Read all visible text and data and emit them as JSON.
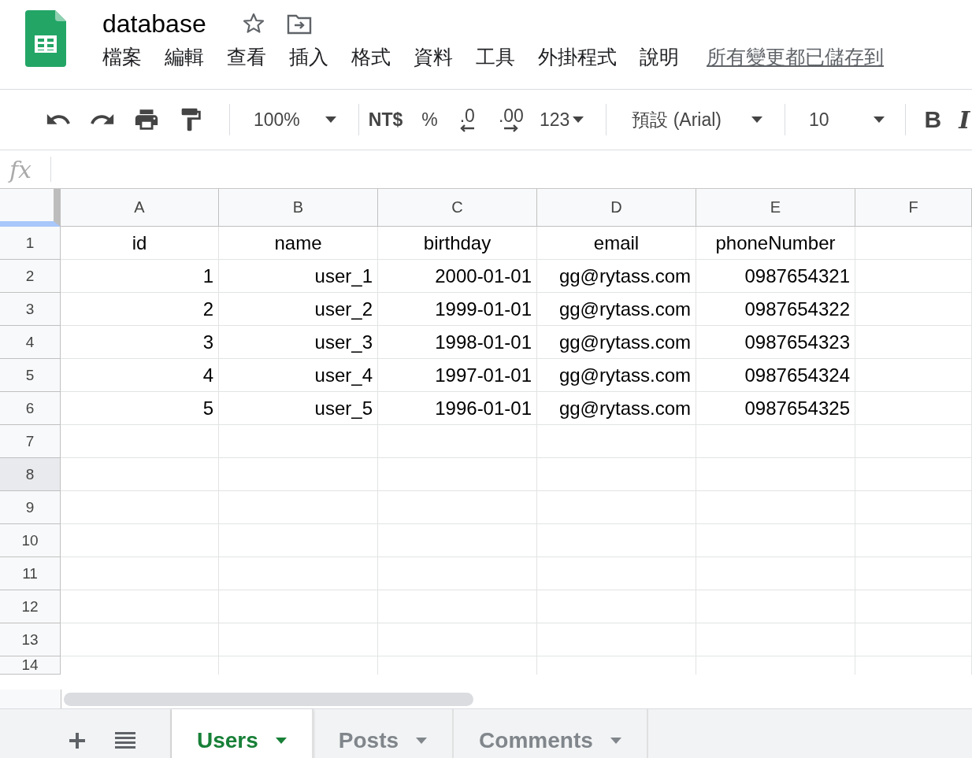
{
  "document": {
    "title": "database"
  },
  "menu": [
    "檔案",
    "編輯",
    "查看",
    "插入",
    "格式",
    "資料",
    "工具",
    "外掛程式",
    "說明"
  ],
  "save_status": "所有變更都已儲存到",
  "toolbar": {
    "zoom": "100%",
    "currency": "NT$",
    "percent": "%",
    "decrease_decimal": ".0",
    "increase_decimal": ".00",
    "more_formats": "123",
    "font": "預設 (Arial)",
    "font_size": "10",
    "bold": "B",
    "italic": "I"
  },
  "formula_bar": {
    "label": "fx"
  },
  "columns": [
    "A",
    "B",
    "C",
    "D",
    "E",
    "F"
  ],
  "rows": [
    {
      "number": "1",
      "selected": false,
      "kind": "header",
      "cells": [
        "id",
        "name",
        "birthday",
        "email",
        "phoneNumber"
      ]
    },
    {
      "number": "2",
      "selected": false,
      "kind": "data",
      "cells": [
        "1",
        "user_1",
        "2000-01-01",
        "gg@rytass.com",
        "0987654321"
      ]
    },
    {
      "number": "3",
      "selected": false,
      "kind": "data",
      "cells": [
        "2",
        "user_2",
        "1999-01-01",
        "gg@rytass.com",
        "0987654322"
      ]
    },
    {
      "number": "4",
      "selected": false,
      "kind": "data",
      "cells": [
        "3",
        "user_3",
        "1998-01-01",
        "gg@rytass.com",
        "0987654323"
      ]
    },
    {
      "number": "5",
      "selected": false,
      "kind": "data",
      "cells": [
        "4",
        "user_4",
        "1997-01-01",
        "gg@rytass.com",
        "0987654324"
      ]
    },
    {
      "number": "6",
      "selected": false,
      "kind": "data",
      "cells": [
        "5",
        "user_5",
        "1996-01-01",
        "gg@rytass.com",
        "0987654325"
      ]
    },
    {
      "number": "7",
      "selected": false,
      "cells": []
    },
    {
      "number": "8",
      "selected": true,
      "cells": []
    },
    {
      "number": "9",
      "selected": false,
      "cells": []
    },
    {
      "number": "10",
      "selected": false,
      "cells": []
    },
    {
      "number": "11",
      "selected": false,
      "cells": []
    },
    {
      "number": "12",
      "selected": false,
      "cells": []
    },
    {
      "number": "13",
      "selected": false,
      "cells": []
    },
    {
      "number": "14",
      "selected": false,
      "cells": []
    }
  ],
  "sheet_tabs": [
    {
      "label": "Users",
      "selected": true
    },
    {
      "label": "Posts",
      "selected": false
    },
    {
      "label": "Comments",
      "selected": false
    }
  ]
}
